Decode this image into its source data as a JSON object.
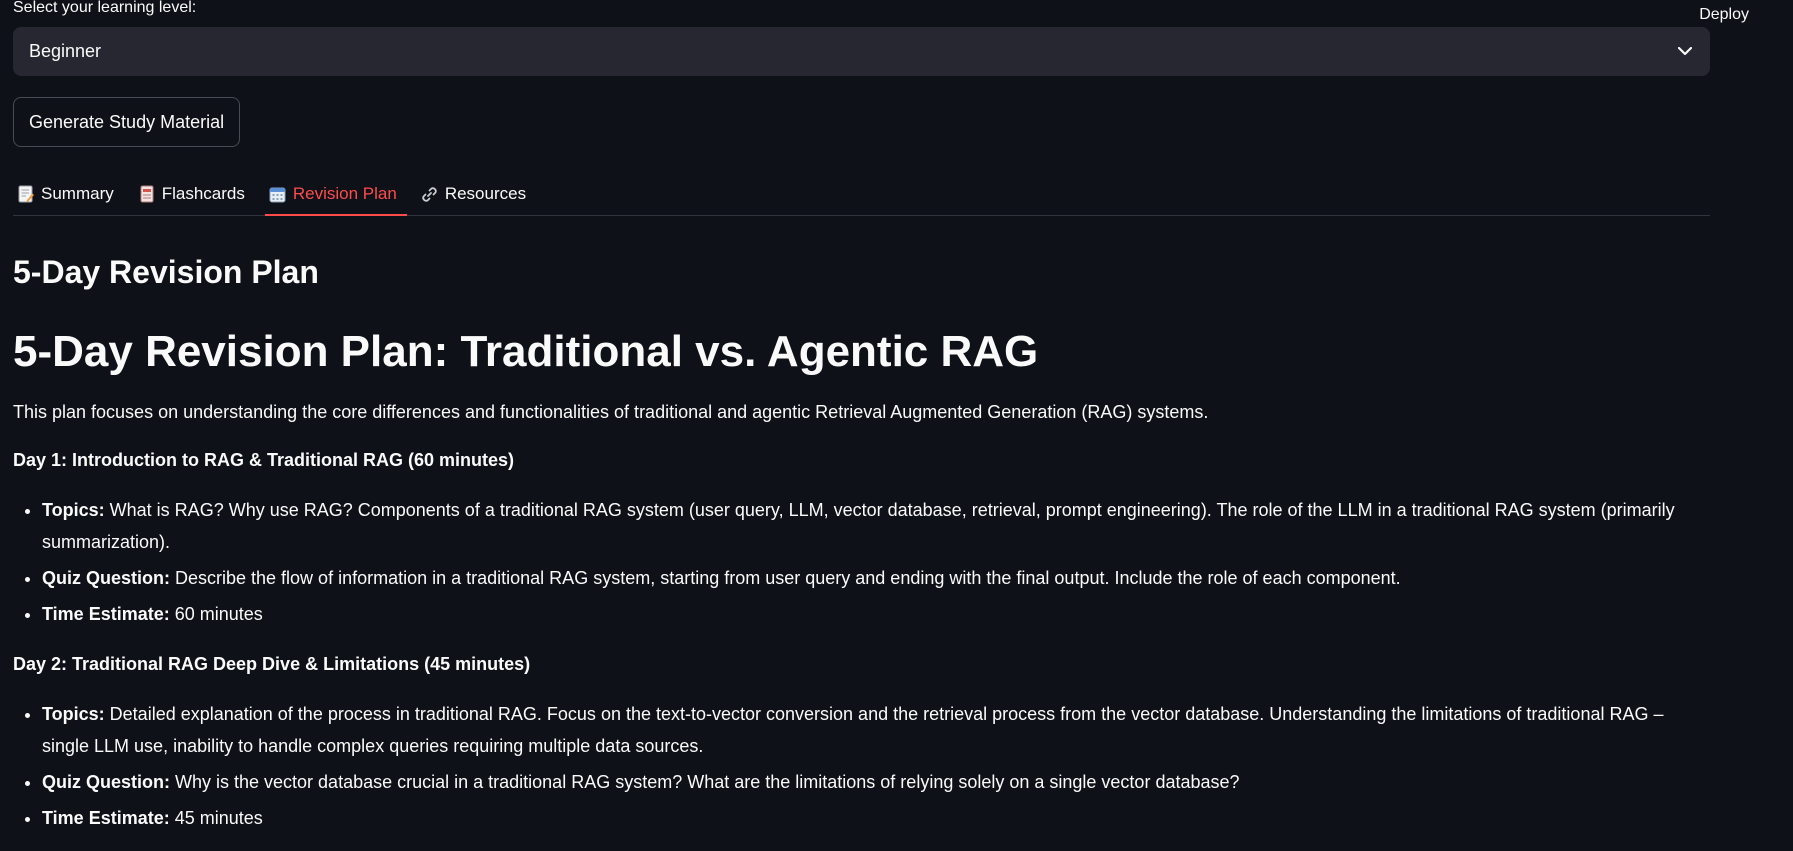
{
  "header": {
    "deploy_label": "Deploy"
  },
  "level_select": {
    "label": "Select your learning level:",
    "value": "Beginner"
  },
  "generate_button": "Generate Study Material",
  "tabs": [
    {
      "label": "Summary",
      "icon": "memo-icon"
    },
    {
      "label": "Flashcards",
      "icon": "card-index-icon"
    },
    {
      "label": "Revision Plan",
      "icon": "calendar-icon",
      "active": true
    },
    {
      "label": "Resources",
      "icon": "link-icon"
    }
  ],
  "content": {
    "section_title": "5-Day Revision Plan",
    "plan_title": "5-Day Revision Plan: Traditional vs. Agentic RAG",
    "intro": "This plan focuses on understanding the core differences and functionalities of traditional and agentic Retrieval Augmented Generation (RAG) systems.",
    "days": [
      {
        "heading": "Day 1: Introduction to RAG & Traditional RAG (60 minutes)",
        "topics_label": "Topics:",
        "topics": " What is RAG? Why use RAG? Components of a traditional RAG system (user query, LLM, vector database, retrieval, prompt engineering). The role of the LLM in a traditional RAG system (primarily summarization).",
        "quiz_label": "Quiz Question:",
        "quiz": " Describe the flow of information in a traditional RAG system, starting from user query and ending with the final output. Include the role of each component.",
        "time_label": "Time Estimate:",
        "time": " 60 minutes"
      },
      {
        "heading": "Day 2: Traditional RAG Deep Dive & Limitations (45 minutes)",
        "topics_label": "Topics:",
        "topics": " Detailed explanation of the process in traditional RAG. Focus on the text-to-vector conversion and the retrieval process from the vector database. Understanding the limitations of traditional RAG – single LLM use, inability to handle complex queries requiring multiple data sources.",
        "quiz_label": "Quiz Question:",
        "quiz": " Why is the vector database crucial in a traditional RAG system? What are the limitations of relying solely on a single vector database?",
        "time_label": "Time Estimate:",
        "time": " 45 minutes"
      }
    ]
  }
}
